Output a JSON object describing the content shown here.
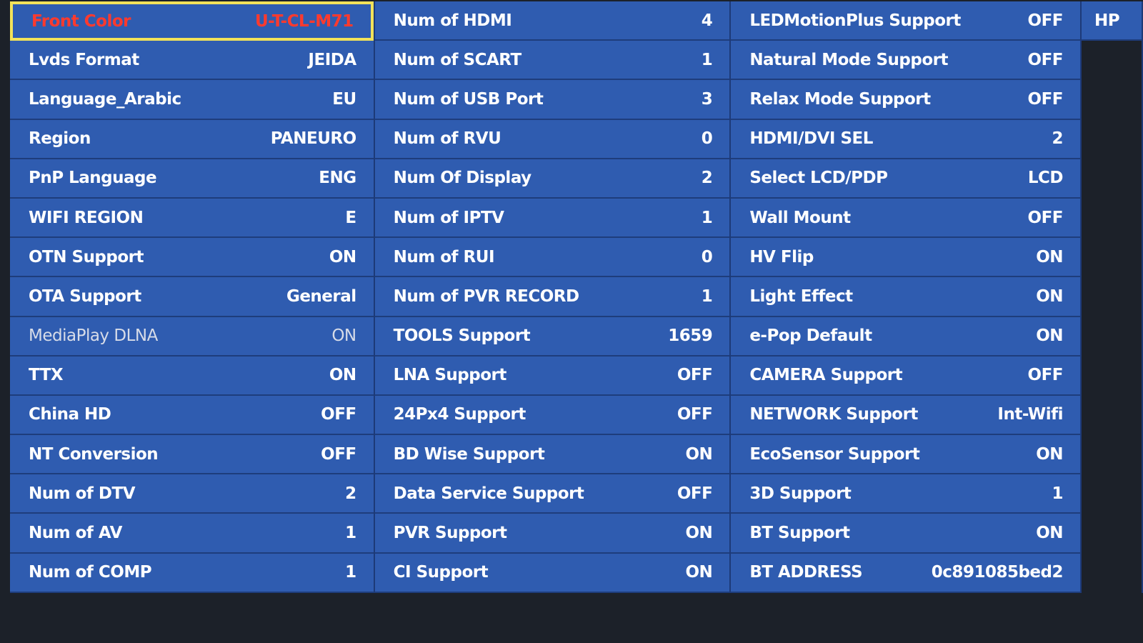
{
  "columns": [
    [
      {
        "label": "Front Color",
        "value": "U-T-CL-M71",
        "selected": true
      },
      {
        "label": "Lvds Format",
        "value": "JEIDA"
      },
      {
        "label": "Language_Arabic",
        "value": "EU"
      },
      {
        "label": "Region",
        "value": "PANEURO"
      },
      {
        "label": "PnP Language",
        "value": "ENG"
      },
      {
        "label": "WIFI REGION",
        "value": "E"
      },
      {
        "label": "OTN Support",
        "value": "ON"
      },
      {
        "label": "OTA Support",
        "value": "General"
      },
      {
        "label": "MediaPlay DLNA",
        "value": "ON",
        "disabled": true
      },
      {
        "label": "TTX",
        "value": "ON"
      },
      {
        "label": "China HD",
        "value": "OFF"
      },
      {
        "label": "NT Conversion",
        "value": "OFF"
      },
      {
        "label": "Num of DTV",
        "value": "2"
      },
      {
        "label": "Num of AV",
        "value": "1"
      },
      {
        "label": "Num of COMP",
        "value": "1"
      }
    ],
    [
      {
        "label": "Num of HDMI",
        "value": "4"
      },
      {
        "label": "Num of SCART",
        "value": "1"
      },
      {
        "label": "Num of USB Port",
        "value": "3"
      },
      {
        "label": "Num of RVU",
        "value": "0"
      },
      {
        "label": "Num Of Display",
        "value": "2"
      },
      {
        "label": "Num of IPTV",
        "value": "1"
      },
      {
        "label": "Num of RUI",
        "value": "0"
      },
      {
        "label": "Num of PVR RECORD",
        "value": "1"
      },
      {
        "label": "TOOLS Support",
        "value": "1659"
      },
      {
        "label": "LNA Support",
        "value": "OFF"
      },
      {
        "label": "24Px4 Support",
        "value": "OFF"
      },
      {
        "label": "BD Wise Support",
        "value": "ON"
      },
      {
        "label": "Data Service Support",
        "value": "OFF"
      },
      {
        "label": "PVR Support",
        "value": "ON"
      },
      {
        "label": "CI Support",
        "value": "ON"
      }
    ],
    [
      {
        "label": "LEDMotionPlus Support",
        "value": "OFF"
      },
      {
        "label": "Natural Mode Support",
        "value": "OFF"
      },
      {
        "label": "Relax Mode Support",
        "value": "OFF"
      },
      {
        "label": "HDMI/DVI SEL",
        "value": "2"
      },
      {
        "label": "Select LCD/PDP",
        "value": "LCD"
      },
      {
        "label": "Wall Mount",
        "value": "OFF"
      },
      {
        "label": "HV Flip",
        "value": "ON"
      },
      {
        "label": "Light Effect",
        "value": "ON"
      },
      {
        "label": "e-Pop Default",
        "value": "ON"
      },
      {
        "label": "CAMERA Support",
        "value": "OFF"
      },
      {
        "label": "NETWORK Support",
        "value": "Int-Wifi"
      },
      {
        "label": "EcoSensor Support",
        "value": "ON"
      },
      {
        "label": "3D Support",
        "value": "1"
      },
      {
        "label": "BT Support",
        "value": "ON"
      },
      {
        "label": "BT ADDRESS",
        "value": "0c891085bed2"
      }
    ],
    [
      {
        "label": "HP",
        "value": ""
      }
    ]
  ],
  "colors": {
    "cell": "#2f5cb0",
    "selection_border": "#f2e25a",
    "selection_text": "#ff3a2e",
    "background": "#1c2129"
  }
}
